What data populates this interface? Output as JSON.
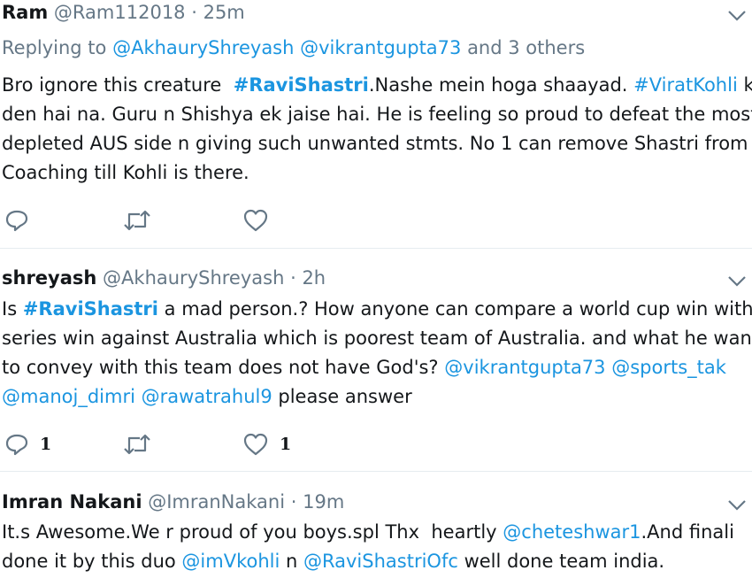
{
  "tweets": [
    {
      "name": "Ram",
      "handle": "@Ram112018",
      "dot": " · ",
      "time": "25m",
      "replying_prefix": "Replying to ",
      "replying_to_1": "@AkhauryShreyash",
      "replying_to_2": "@vikrantgupta73",
      "replying_suffix": " and 3 others",
      "lines": [
        [
          "Bro ignore this creature  ",
          "#RaviShastri",
          ".Nashe mein hoga shaayad. ",
          "#ViratKohli",
          " ki"
        ],
        [
          "den hai na. Guru n Shishya ek jaise hai. He is feeling so proud to defeat the most"
        ],
        [
          "depleted AUS side n giving such unwanted stmts. No 1 can remove Shastri from"
        ],
        [
          "Coaching till Kohli is there."
        ]
      ],
      "reply_count": "",
      "retweet_count": "",
      "like_count": ""
    },
    {
      "name": "shreyash",
      "handle": "@AkhauryShreyash",
      "dot": " · ",
      "time": "2h",
      "lines": [
        [
          "Is ",
          "#RaviShastri",
          " a mad person.? How anyone can compare a world cup win with a"
        ],
        [
          "series win against Australia which is poorest team of Australia. and what he want"
        ],
        [
          "to convey with this team does not have God's? ",
          "@vikrantgupta73",
          " ",
          "@sports_tak"
        ],
        [
          "@manoj_dimri",
          " ",
          "@rawatrahul9",
          " please answer"
        ]
      ],
      "reply_count": "1",
      "retweet_count": "",
      "like_count": "1"
    },
    {
      "name": "Imran Nakani",
      "handle": "@ImranNakani",
      "dot": " · ",
      "time": "19m",
      "lines": [
        [
          "It.s Awesome.We r proud of you boys.spl Thx  heartly ",
          "@cheteshwar1",
          ".And finali"
        ],
        [
          "done it by this duo ",
          "@imVkohli",
          " n ",
          "@RaviShastriOfc",
          " well done team india."
        ]
      ]
    }
  ],
  "icons": {
    "reply": "reply-icon",
    "retweet": "retweet-icon",
    "like": "heart-icon",
    "more": "chevron-down-icon"
  },
  "colors": {
    "text": "#14171a",
    "muted": "#657786",
    "link": "#1b95e0",
    "divider": "#e6ecf0"
  }
}
